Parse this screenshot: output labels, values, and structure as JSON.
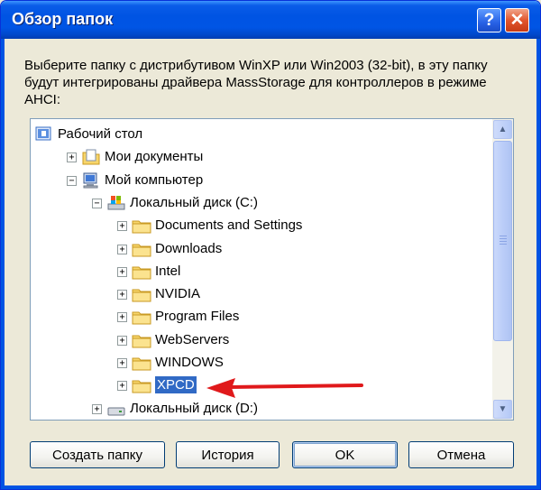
{
  "window": {
    "title": "Обзор папок",
    "help_label": "?",
    "close_label": "✕"
  },
  "description": "Выберите папку с дистрибутивом WinXP или Win2003 (32-bit), в эту папку будут интегрированы драйвера MassStorage для контроллеров в режиме AHCI:",
  "tree": {
    "items": [
      {
        "label": "Рабочий стол",
        "icon": "desktop-icon",
        "expander": ""
      },
      {
        "label": "Мои документы",
        "icon": "my-documents-icon",
        "expander": "+"
      },
      {
        "label": "Мой компьютер",
        "icon": "my-computer-icon",
        "expander": "−"
      },
      {
        "label": "Локальный диск (C:)",
        "icon": "local-disk-icon",
        "expander": "−"
      },
      {
        "label": "Documents and Settings",
        "icon": "folder-icon",
        "expander": "+"
      },
      {
        "label": "Downloads",
        "icon": "folder-icon",
        "expander": "+"
      },
      {
        "label": "Intel",
        "icon": "folder-icon",
        "expander": "+"
      },
      {
        "label": "NVIDIA",
        "icon": "folder-icon",
        "expander": "+"
      },
      {
        "label": "Program Files",
        "icon": "folder-icon",
        "expander": "+"
      },
      {
        "label": "WebServers",
        "icon": "folder-icon",
        "expander": "+"
      },
      {
        "label": "WINDOWS",
        "icon": "folder-icon",
        "expander": "+"
      },
      {
        "label": "XPCD",
        "icon": "folder-icon",
        "expander": "+",
        "selected": true
      },
      {
        "label": "Локальный диск (D:)",
        "icon": "drive-icon",
        "expander": "+"
      }
    ]
  },
  "buttons": {
    "new_folder": "Создать папку",
    "history": "История",
    "ok": "OK",
    "cancel": "Отмена"
  },
  "colors": {
    "titlebar": "#0054e3",
    "selection": "#316ac5",
    "arrow": "#e0191b"
  }
}
